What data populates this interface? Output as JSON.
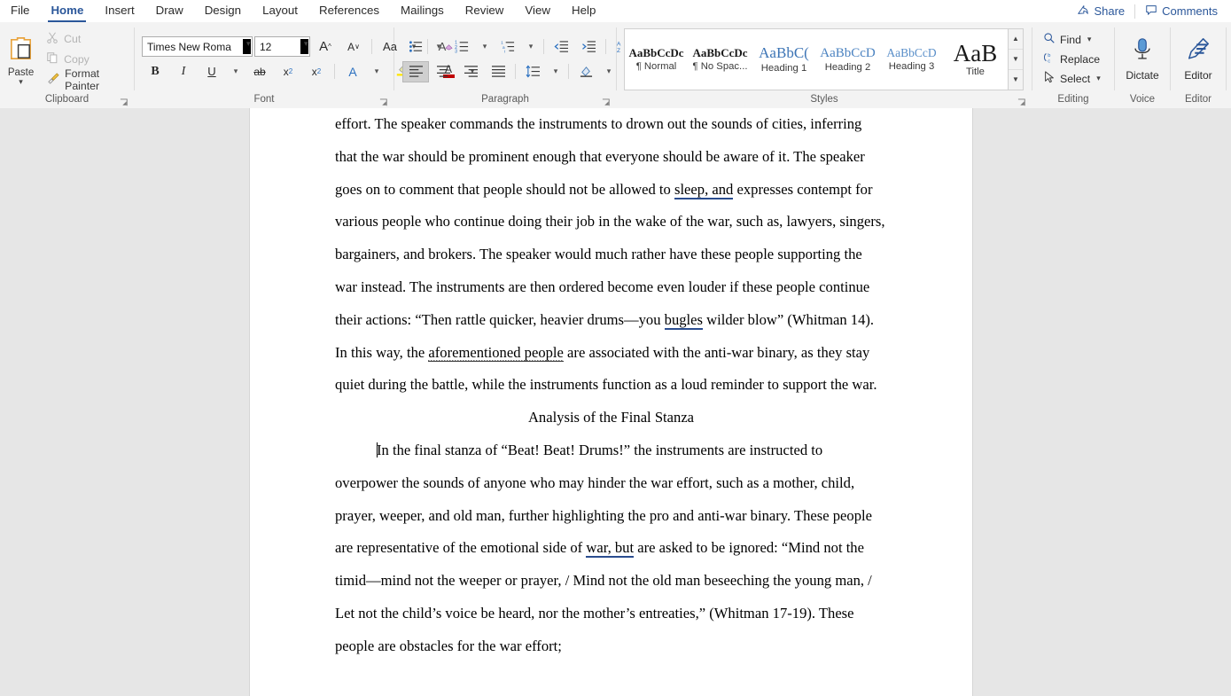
{
  "window": {
    "app": "Microsoft Word"
  },
  "tabs": [
    {
      "label": "File",
      "active": false
    },
    {
      "label": "Home",
      "active": true
    },
    {
      "label": "Insert",
      "active": false
    },
    {
      "label": "Draw",
      "active": false
    },
    {
      "label": "Design",
      "active": false
    },
    {
      "label": "Layout",
      "active": false
    },
    {
      "label": "References",
      "active": false
    },
    {
      "label": "Mailings",
      "active": false
    },
    {
      "label": "Review",
      "active": false
    },
    {
      "label": "View",
      "active": false
    },
    {
      "label": "Help",
      "active": false
    }
  ],
  "titlebar_right": {
    "share_label": "Share",
    "comments_label": "Comments"
  },
  "ribbon": {
    "clipboard": {
      "group_label": "Clipboard",
      "paste_label": "Paste",
      "cut_label": "Cut",
      "copy_label": "Copy",
      "format_painter_label": "Format Painter"
    },
    "font": {
      "group_label": "Font",
      "font_name_value": "Times New Roma",
      "font_size_value": "12",
      "grow_font": "A",
      "shrink_font": "A",
      "change_case": "Aa",
      "clear_formatting": "A",
      "bold": "B",
      "italic": "I",
      "underline": "U",
      "strikethrough": "ab",
      "subscript": "x",
      "superscript": "x",
      "text_effects": "A",
      "highlight": "A",
      "font_color": "A"
    },
    "paragraph": {
      "group_label": "Paragraph"
    },
    "styles": {
      "group_label": "Styles",
      "items": [
        {
          "preview": "AaBbCcDc",
          "name": "¶ Normal",
          "color": "#1a1a1a",
          "size": "13px",
          "weight": "bold"
        },
        {
          "preview": "AaBbCcDc",
          "name": "¶ No Spac...",
          "color": "#1a1a1a",
          "size": "13px",
          "weight": "bold"
        },
        {
          "preview": "AaBbC(",
          "name": "Heading 1",
          "color": "#3c74b5",
          "size": "17px",
          "weight": "normal"
        },
        {
          "preview": "AaBbCcD",
          "name": "Heading 2",
          "color": "#4a82c0",
          "size": "15px",
          "weight": "normal"
        },
        {
          "preview": "AaBbCcD",
          "name": "Heading 3",
          "color": "#5a8fc9",
          "size": "13.5px",
          "weight": "normal"
        },
        {
          "preview": "AaB",
          "name": "Title",
          "color": "#1a1a1a",
          "size": "26px",
          "weight": "normal"
        }
      ]
    },
    "editing": {
      "group_label": "Editing",
      "find_label": "Find",
      "replace_label": "Replace",
      "select_label": "Select"
    },
    "voice": {
      "group_label": "Voice",
      "dictate_label": "Dictate"
    },
    "editor": {
      "group_label": "Editor",
      "editor_label": "Editor"
    }
  },
  "document": {
    "paragraph_1": {
      "part_a": "effort. The speaker commands the instruments to drown out the sounds of cities, inferring that the war should be prominent enough that everyone should be aware of it. The speaker goes on to comment that people should not be allowed to ",
      "grammar_1": "sleep, and",
      "part_b": " expresses contempt for various people who continue doing their job in the wake of the war, such as, lawyers, singers, bargainers, and brokers. The speaker would much rather have these people supporting the war instead. The instruments are then ordered become even louder if these people continue their actions: “Then rattle quicker, heavier drums—you ",
      "grammar_2": "bugles",
      "part_c": " wilder blow” (Whitman 14). In this way, the ",
      "grammar_3": "aforementioned people",
      "part_d": " are associated with the anti-war binary, as they stay quiet during the battle, while the instruments function as a loud reminder to support the war."
    },
    "heading": "Analysis of the Final Stanza",
    "paragraph_2": {
      "part_a": "In the final stanza of “Beat! Beat! Drums!” the instruments are instructed to overpower the sounds of anyone who may hinder the war effort, such as a mother, child, prayer, weeper, and old man, further highlighting the pro and anti-war binary. These people are representative of the emotional side of ",
      "grammar_1": "war, but",
      "part_b": " are asked to be ignored: “Mind not the timid—mind not the weeper or prayer, / Mind not the old man beseeching the young man, / Let not the child’s voice be heard, nor the mother’s entreaties,” (Whitman 17-19). These people are obstacles for the war effort;"
    }
  },
  "colors": {
    "accent": "#2b579a",
    "ribbon_bg": "#f3f3f3",
    "canvas_bg": "#e6e6e6",
    "page_bg": "#ffffff",
    "grammar_underline": "#2a4d8f"
  }
}
